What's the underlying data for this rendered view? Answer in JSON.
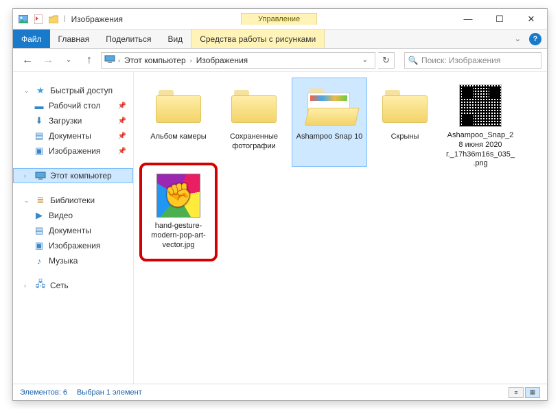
{
  "titlebar": {
    "title": "Изображения",
    "tab_context": "Управление"
  },
  "tabs": {
    "file": "Файл",
    "home": "Главная",
    "share": "Поделиться",
    "view": "Вид",
    "picturetools": "Средства работы с рисунками"
  },
  "nav": {
    "root": "Этот компьютер",
    "folder": "Изображения",
    "search_placeholder": "Поиск: Изображения"
  },
  "tree": {
    "quick": "Быстрый доступ",
    "desktop": "Рабочий стол",
    "downloads": "Загрузки",
    "documents": "Документы",
    "pictures": "Изображения",
    "thispc": "Этот компьютер",
    "libraries": "Библиотеки",
    "video": "Видео",
    "lib_documents": "Документы",
    "lib_pictures": "Изображения",
    "music": "Музыка",
    "network": "Сеть"
  },
  "items": [
    {
      "label": "Альбом камеры",
      "type": "folder"
    },
    {
      "label": "Сохраненные фотографии",
      "type": "folder"
    },
    {
      "label": "Ashampoo Snap 10",
      "type": "folder-open",
      "selected": true
    },
    {
      "label": "Скрыны",
      "type": "folder"
    },
    {
      "label": "Ashampoo_Snap_28 июня 2020 г._17h36m16s_035_.png",
      "type": "qr"
    },
    {
      "label": "hand-gesture-modern-pop-art-vector.jpg",
      "type": "popart",
      "highlighted": true
    }
  ],
  "status": {
    "count": "Элементов: 6",
    "selected": "Выбран 1 элемент"
  }
}
